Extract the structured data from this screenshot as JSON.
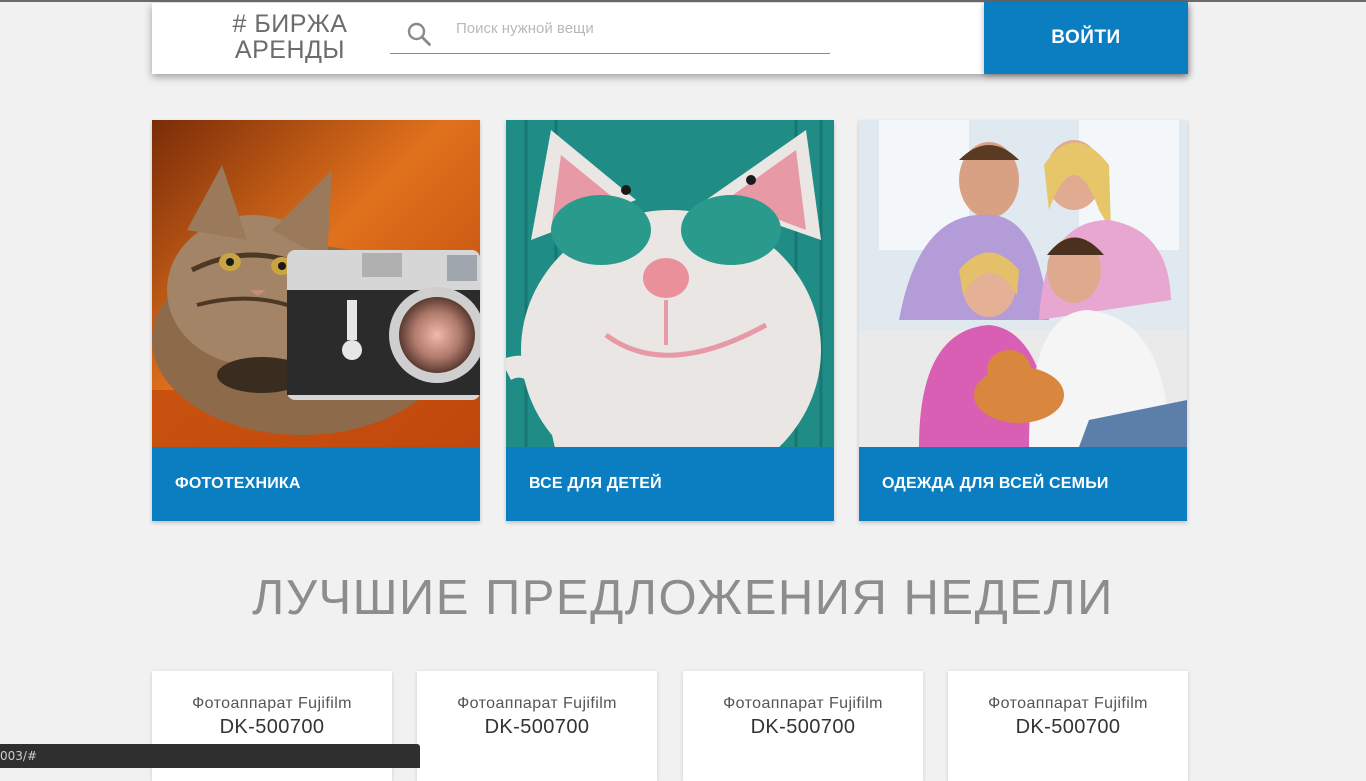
{
  "header": {
    "logo_line1": "# БИРЖА",
    "logo_line2": "АРЕНДЫ",
    "search_placeholder": "Поиск нужной вещи",
    "login_label": "ВОЙТИ"
  },
  "categories": [
    {
      "label": "ФОТОТЕХНИКА",
      "image": "kitten-with-camera"
    },
    {
      "label": "ВСЕ ДЛЯ ДЕТЕЙ",
      "image": "knitted-cat-toy"
    },
    {
      "label": "ОДЕЖДА ДЛЯ ВСЕЙ СЕМЬИ",
      "image": "family-with-cat"
    }
  ],
  "section_title": "ЛУЧШИЕ ПРЕДЛОЖЕНИЯ НЕДЕЛИ",
  "offers": [
    {
      "title": "Фотоаппарат Fujifilm",
      "model": "DK-500700"
    },
    {
      "title": "Фотоаппарат Fujifilm",
      "model": "DK-500700"
    },
    {
      "title": "Фотоаппарат Fujifilm",
      "model": "DK-500700"
    },
    {
      "title": "Фотоаппарат Fujifilm",
      "model": "DK-500700"
    }
  ],
  "status_bar": {
    "url": "003/#"
  },
  "colors": {
    "accent": "#0b7dc1",
    "background": "#f1f1f1",
    "title_gray": "#8d8d8d"
  }
}
